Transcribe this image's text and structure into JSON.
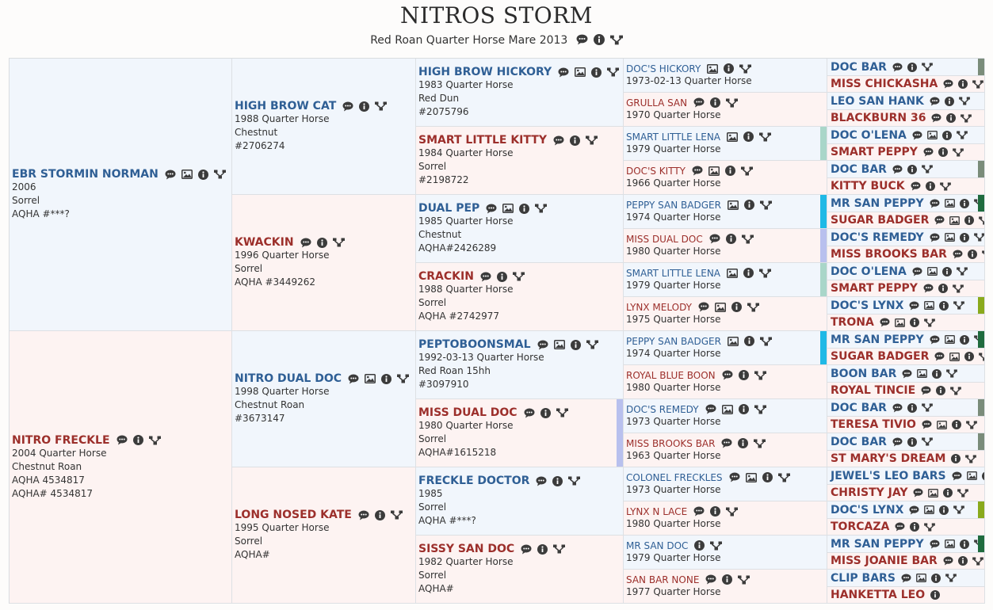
{
  "title": "NITROS STORM",
  "subtitle": "Red Roan Quarter Horse Mare 2013",
  "subtitle_icons": [
    "comment-icon",
    "info-icon",
    "pedigree-icon"
  ],
  "pedigree": {
    "g1": [
      {
        "name": "EBR STORMIN NORMAN",
        "sex": "m",
        "lines": [
          "2006",
          "Sorrel",
          "AQHA #***?"
        ],
        "icons": [
          "comment-icon",
          "photo-icon",
          "info-icon",
          "pedigree-icon"
        ]
      },
      {
        "name": "NITRO FRECKLE",
        "sex": "f",
        "lines": [
          "2004 Quarter Horse",
          "Chestnut Roan",
          "AQHA 4534817",
          "AQHA# 4534817"
        ],
        "icons": [
          "comment-icon",
          "info-icon",
          "pedigree-icon"
        ]
      }
    ],
    "g2": [
      {
        "name": "HIGH BROW CAT",
        "sex": "m",
        "lines": [
          "1988 Quarter Horse",
          "Chestnut",
          "#2706274"
        ],
        "icons": [
          "comment-icon",
          "info-icon",
          "pedigree-icon"
        ]
      },
      {
        "name": "KWACKIN",
        "sex": "f",
        "lines": [
          "1996 Quarter Horse",
          "Sorrel",
          "AQHA #3449262"
        ],
        "icons": [
          "comment-icon",
          "info-icon",
          "pedigree-icon"
        ]
      },
      {
        "name": "NITRO DUAL DOC",
        "sex": "m",
        "lines": [
          "1998 Quarter Horse",
          "Chestnut Roan",
          "#3673147"
        ],
        "icons": [
          "comment-icon",
          "photo-icon",
          "info-icon",
          "pedigree-icon"
        ]
      },
      {
        "name": "LONG NOSED KATE",
        "sex": "f",
        "lines": [
          "1995 Quarter Horse",
          "Sorrel",
          "AQHA#"
        ],
        "icons": [
          "comment-icon",
          "info-icon",
          "pedigree-icon"
        ]
      }
    ],
    "g3": [
      {
        "name": "HIGH BROW HICKORY",
        "sex": "m",
        "lines": [
          "1983 Quarter Horse",
          "Red Dun",
          "#2075796"
        ],
        "icons": [
          "comment-icon",
          "photo-icon",
          "info-icon",
          "pedigree-icon"
        ]
      },
      {
        "name": "SMART LITTLE KITTY",
        "sex": "f",
        "lines": [
          "1984 Quarter Horse",
          "Sorrel",
          "#2198722"
        ],
        "icons": [
          "comment-icon",
          "info-icon",
          "pedigree-icon"
        ]
      },
      {
        "name": "DUAL PEP",
        "sex": "m",
        "lines": [
          "1985 Quarter Horse",
          "Chestnut",
          "AQHA#2426289"
        ],
        "icons": [
          "comment-icon",
          "photo-icon",
          "info-icon",
          "pedigree-icon"
        ]
      },
      {
        "name": "CRACKIN",
        "sex": "f",
        "lines": [
          "1988 Quarter Horse",
          "Sorrel",
          "AQHA #2742977"
        ],
        "icons": [
          "comment-icon",
          "info-icon",
          "pedigree-icon"
        ]
      },
      {
        "name": "PEPTOBOONSMAL",
        "sex": "m",
        "lines": [
          "1992-03-13 Quarter Horse",
          "Red Roan 15hh",
          "#3097910"
        ],
        "icons": [
          "comment-icon",
          "photo-icon",
          "info-icon",
          "pedigree-icon"
        ]
      },
      {
        "name": "MISS DUAL DOC",
        "sex": "f",
        "lines": [
          "1980 Quarter Horse",
          "Sorrel",
          "AQHA#1615218"
        ],
        "icons": [
          "comment-icon",
          "info-icon",
          "pedigree-icon"
        ],
        "bar": "#b8c0ee"
      },
      {
        "name": "FRECKLE DOCTOR",
        "sex": "m",
        "lines": [
          "1985",
          "Sorrel",
          "AQHA #***?"
        ],
        "icons": [
          "comment-icon",
          "info-icon",
          "pedigree-icon"
        ]
      },
      {
        "name": "SISSY SAN DOC",
        "sex": "f",
        "lines": [
          "1982 Quarter Horse",
          "Sorrel",
          "AQHA#"
        ],
        "icons": [
          "comment-icon",
          "info-icon",
          "pedigree-icon"
        ]
      }
    ],
    "g4": [
      {
        "name": "DOC'S HICKORY",
        "sex": "m",
        "lines": [
          "1973-02-13 Quarter Horse"
        ],
        "icons": [
          "photo-icon",
          "info-icon",
          "pedigree-icon"
        ]
      },
      {
        "name": "GRULLA SAN",
        "sex": "f",
        "lines": [
          "1970 Quarter Horse"
        ],
        "icons": [
          "comment-icon",
          "info-icon",
          "pedigree-icon"
        ]
      },
      {
        "name": "SMART LITTLE LENA",
        "sex": "m",
        "lines": [
          "1979 Quarter Horse"
        ],
        "icons": [
          "photo-icon",
          "info-icon",
          "pedigree-icon"
        ],
        "bar": "#a9d6c9"
      },
      {
        "name": "DOC'S KITTY",
        "sex": "f",
        "lines": [
          "1966 Quarter Horse"
        ],
        "icons": [
          "comment-icon",
          "photo-icon",
          "info-icon",
          "pedigree-icon"
        ]
      },
      {
        "name": "PEPPY SAN BADGER",
        "sex": "m",
        "lines": [
          "1974 Quarter Horse"
        ],
        "icons": [
          "photo-icon",
          "info-icon",
          "pedigree-icon"
        ],
        "bar": "#1fb9e6"
      },
      {
        "name": "MISS DUAL DOC",
        "sex": "f",
        "lines": [
          "1980 Quarter Horse"
        ],
        "icons": [
          "comment-icon",
          "info-icon",
          "pedigree-icon"
        ],
        "bar": "#b8c0ee"
      },
      {
        "name": "SMART LITTLE LENA",
        "sex": "m",
        "lines": [
          "1979 Quarter Horse"
        ],
        "icons": [
          "photo-icon",
          "info-icon",
          "pedigree-icon"
        ],
        "bar": "#a9d6c9"
      },
      {
        "name": "LYNX MELODY",
        "sex": "f",
        "lines": [
          "1975 Quarter Horse"
        ],
        "icons": [
          "comment-icon",
          "photo-icon",
          "info-icon",
          "pedigree-icon"
        ]
      },
      {
        "name": "PEPPY SAN BADGER",
        "sex": "m",
        "lines": [
          "1974 Quarter Horse"
        ],
        "icons": [
          "photo-icon",
          "info-icon",
          "pedigree-icon"
        ],
        "bar": "#1fb9e6"
      },
      {
        "name": "ROYAL BLUE BOON",
        "sex": "f",
        "lines": [
          "1980 Quarter Horse"
        ],
        "icons": [
          "comment-icon",
          "info-icon",
          "pedigree-icon"
        ]
      },
      {
        "name": "DOC'S REMEDY",
        "sex": "m",
        "lines": [
          "1973 Quarter Horse"
        ],
        "icons": [
          "comment-icon",
          "photo-icon",
          "info-icon",
          "pedigree-icon"
        ]
      },
      {
        "name": "MISS BROOKS BAR",
        "sex": "f",
        "lines": [
          "1963 Quarter Horse"
        ],
        "icons": [
          "comment-icon",
          "info-icon",
          "pedigree-icon"
        ]
      },
      {
        "name": "COLONEL FRECKLES",
        "sex": "m",
        "lines": [
          "1973 Quarter Horse"
        ],
        "icons": [
          "comment-icon",
          "photo-icon",
          "info-icon",
          "pedigree-icon"
        ]
      },
      {
        "name": "LYNX N LACE",
        "sex": "f",
        "lines": [
          "1980 Quarter Horse"
        ],
        "icons": [
          "comment-icon",
          "info-icon",
          "pedigree-icon"
        ]
      },
      {
        "name": "MR SAN DOC",
        "sex": "m",
        "lines": [
          "1979 Quarter Horse"
        ],
        "icons": [
          "info-icon",
          "pedigree-icon"
        ]
      },
      {
        "name": "SAN BAR NONE",
        "sex": "f",
        "lines": [
          "1977 Quarter Horse"
        ],
        "icons": [
          "comment-icon",
          "info-icon",
          "pedigree-icon"
        ]
      }
    ],
    "g5": [
      {
        "name": "DOC BAR",
        "sex": "m",
        "icons": [
          "comment-icon",
          "info-icon",
          "pedigree-icon"
        ],
        "bar": "#7a8c7a"
      },
      {
        "name": "MISS CHICKASHA",
        "sex": "f",
        "icons": [
          "comment-icon",
          "info-icon",
          "pedigree-icon"
        ]
      },
      {
        "name": "LEO SAN HANK",
        "sex": "m",
        "icons": [
          "comment-icon",
          "info-icon",
          "pedigree-icon"
        ]
      },
      {
        "name": "BLACKBURN 36",
        "sex": "f",
        "icons": [
          "comment-icon",
          "info-icon",
          "pedigree-icon"
        ]
      },
      {
        "name": "DOC O'LENA",
        "sex": "m",
        "icons": [
          "comment-icon",
          "photo-icon",
          "info-icon",
          "pedigree-icon"
        ]
      },
      {
        "name": "SMART PEPPY",
        "sex": "f",
        "icons": [
          "comment-icon",
          "info-icon",
          "pedigree-icon"
        ]
      },
      {
        "name": "DOC BAR",
        "sex": "m",
        "icons": [
          "comment-icon",
          "info-icon",
          "pedigree-icon"
        ],
        "bar": "#7a8c7a"
      },
      {
        "name": "KITTY BUCK",
        "sex": "f",
        "icons": [
          "comment-icon",
          "info-icon",
          "pedigree-icon"
        ]
      },
      {
        "name": "MR SAN PEPPY",
        "sex": "m",
        "icons": [
          "comment-icon",
          "photo-icon",
          "info-icon",
          "pedigree-icon"
        ],
        "bar": "#1f6b3e"
      },
      {
        "name": "SUGAR BADGER",
        "sex": "f",
        "icons": [
          "comment-icon",
          "photo-icon",
          "info-icon",
          "pedigree-icon"
        ]
      },
      {
        "name": "DOC'S REMEDY",
        "sex": "m",
        "icons": [
          "comment-icon",
          "photo-icon",
          "info-icon",
          "pedigree-icon"
        ]
      },
      {
        "name": "MISS BROOKS BAR",
        "sex": "f",
        "icons": [
          "comment-icon",
          "info-icon",
          "pedigree-icon"
        ]
      },
      {
        "name": "DOC O'LENA",
        "sex": "m",
        "icons": [
          "comment-icon",
          "photo-icon",
          "info-icon",
          "pedigree-icon"
        ]
      },
      {
        "name": "SMART PEPPY",
        "sex": "f",
        "icons": [
          "comment-icon",
          "info-icon",
          "pedigree-icon"
        ]
      },
      {
        "name": "DOC'S LYNX",
        "sex": "m",
        "icons": [
          "comment-icon",
          "photo-icon",
          "info-icon",
          "pedigree-icon"
        ],
        "bar": "#8aaa1c"
      },
      {
        "name": "TRONA",
        "sex": "f",
        "icons": [
          "comment-icon",
          "photo-icon",
          "info-icon",
          "pedigree-icon"
        ]
      },
      {
        "name": "MR SAN PEPPY",
        "sex": "m",
        "icons": [
          "comment-icon",
          "photo-icon",
          "info-icon",
          "pedigree-icon"
        ],
        "bar": "#1f6b3e"
      },
      {
        "name": "SUGAR BADGER",
        "sex": "f",
        "icons": [
          "comment-icon",
          "photo-icon",
          "info-icon",
          "pedigree-icon"
        ]
      },
      {
        "name": "BOON BAR",
        "sex": "m",
        "icons": [
          "comment-icon",
          "photo-icon",
          "info-icon",
          "pedigree-icon"
        ]
      },
      {
        "name": "ROYAL TINCIE",
        "sex": "f",
        "icons": [
          "comment-icon",
          "info-icon",
          "pedigree-icon"
        ]
      },
      {
        "name": "DOC BAR",
        "sex": "m",
        "icons": [
          "comment-icon",
          "info-icon",
          "pedigree-icon"
        ],
        "bar": "#7a8c7a"
      },
      {
        "name": "TERESA TIVIO",
        "sex": "f",
        "icons": [
          "comment-icon",
          "photo-icon",
          "info-icon",
          "pedigree-icon"
        ]
      },
      {
        "name": "DOC BAR",
        "sex": "m",
        "icons": [
          "comment-icon",
          "info-icon",
          "pedigree-icon"
        ],
        "bar": "#7a8c7a"
      },
      {
        "name": "ST MARY'S DREAM",
        "sex": "f",
        "icons": [
          "info-icon",
          "pedigree-icon"
        ]
      },
      {
        "name": "JEWEL'S LEO BARS",
        "sex": "m",
        "icons": [
          "comment-icon",
          "photo-icon",
          "info-icon",
          "pedigree-icon"
        ]
      },
      {
        "name": "CHRISTY JAY",
        "sex": "f",
        "icons": [
          "comment-icon",
          "photo-icon",
          "info-icon",
          "pedigree-icon"
        ]
      },
      {
        "name": "DOC'S LYNX",
        "sex": "m",
        "icons": [
          "comment-icon",
          "photo-icon",
          "info-icon",
          "pedigree-icon"
        ],
        "bar": "#8aaa1c"
      },
      {
        "name": "TORCAZA",
        "sex": "f",
        "icons": [
          "comment-icon",
          "info-icon",
          "pedigree-icon"
        ]
      },
      {
        "name": "MR SAN PEPPY",
        "sex": "m",
        "icons": [
          "comment-icon",
          "photo-icon",
          "info-icon",
          "pedigree-icon"
        ],
        "bar": "#1f6b3e"
      },
      {
        "name": "MISS JOANIE BAR",
        "sex": "f",
        "icons": [
          "comment-icon",
          "info-icon",
          "pedigree-icon"
        ]
      },
      {
        "name": "CLIP BARS",
        "sex": "m",
        "icons": [
          "comment-icon",
          "photo-icon",
          "info-icon",
          "pedigree-icon"
        ]
      },
      {
        "name": "HANKETTA LEO",
        "sex": "f",
        "icons": [
          "info-icon"
        ]
      }
    ]
  }
}
